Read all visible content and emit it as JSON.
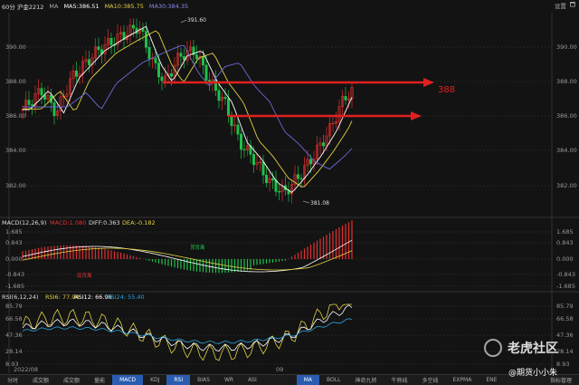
{
  "header": {
    "symbol": "60分 沪金2212",
    "indicator": "MA",
    "ma5": "MA5:386.51",
    "ma10": "MA10:385.75",
    "ma30": "MA30:384.35",
    "right_labels": [
      "设置",
      "🗖"
    ]
  },
  "price_axis": [
    "390.00",
    "388.00",
    "386.00",
    "384.00",
    "382.00"
  ],
  "annotations": {
    "high": "391.60",
    "low": "381.08",
    "target": "388"
  },
  "macd": {
    "header": "MACD(12,26,9)",
    "macd_val": "MACD:1.080",
    "diff": "DIFF:0.363",
    "dea": "DEA:-0.182",
    "axis": [
      "1.685",
      "0.843",
      "0.000",
      "-0.843",
      "-1.685"
    ],
    "tag1": "底背离",
    "tag2": "顶背离"
  },
  "rsi": {
    "header": "RSI(6,12,24)",
    "rsi6": "RSI6: 77.94",
    "rsi12": "RSI12: 66.96",
    "rsi24": "RSI24: 55.40",
    "axis": [
      "85.79",
      "66.58",
      "47.36",
      "28.14",
      "8.93"
    ]
  },
  "xaxis": {
    "left": "2022/08",
    "mid": "09"
  },
  "bottom_tabs": [
    {
      "label": "分时",
      "on": false
    },
    {
      "label": "成交额",
      "on": false
    },
    {
      "label": "成交额",
      "on": false
    },
    {
      "label": "量能",
      "on": false
    },
    {
      "label": "MACD",
      "on": true
    },
    {
      "label": "KDJ",
      "on": false
    },
    {
      "label": "RSI",
      "on": true
    },
    {
      "label": "BIAS",
      "on": false
    },
    {
      "label": "WR",
      "on": false
    },
    {
      "label": "ASI",
      "on": false
    }
  ],
  "bottom_tabs2": [
    {
      "label": "MA",
      "on": true
    },
    {
      "label": "BOLL",
      "on": false
    },
    {
      "label": "神奇九转",
      "on": false
    },
    {
      "label": "牛熊线",
      "on": false
    },
    {
      "label": "多空线",
      "on": false
    },
    {
      "label": "EXPMA",
      "on": false
    },
    {
      "label": "ENE",
      "on": false
    }
  ],
  "bottom_right": "指标管理",
  "watermark": {
    "brand": "老虎社区",
    "user": "@期货小小朱"
  },
  "colors": {
    "up": "#e03030",
    "down": "#1fbf4a",
    "ma5": "#ffffff",
    "ma10": "#e0d040",
    "ma30": "#6a6ad8",
    "rsi6": "#e0d040",
    "rsi12": "#ffffff",
    "rsi24": "#2aa4e0"
  }
}
